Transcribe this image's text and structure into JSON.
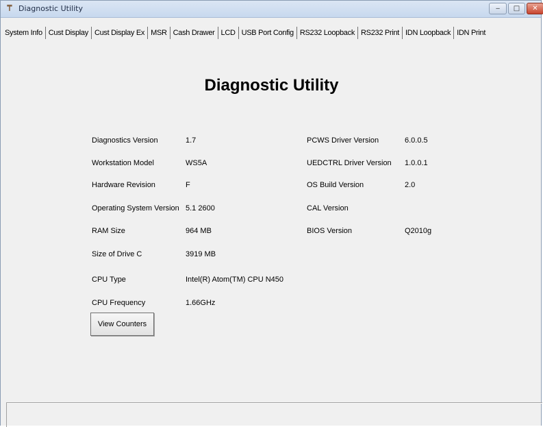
{
  "window": {
    "title": "Diagnostic Utility",
    "minimize": "‒",
    "maximize": "□",
    "close": "✕"
  },
  "tabs": [
    {
      "label": "System Info"
    },
    {
      "label": "Cust Display"
    },
    {
      "label": "Cust Display Ex"
    },
    {
      "label": "MSR"
    },
    {
      "label": "Cash Drawer"
    },
    {
      "label": "LCD"
    },
    {
      "label": "USB Port Config"
    },
    {
      "label": "RS232 Loopback"
    },
    {
      "label": "RS232 Print"
    },
    {
      "label": "IDN Loopback"
    },
    {
      "label": "IDN Print"
    }
  ],
  "heading": "Diagnostic Utility",
  "left_fields": [
    {
      "label": "Diagnostics Version",
      "value": "1.7"
    },
    {
      "label": "Workstation Model",
      "value": "WS5A"
    },
    {
      "label": "Hardware Revision",
      "value": "F"
    },
    {
      "label": "Operating System Version",
      "value": "5.1 2600"
    },
    {
      "label": "RAM Size",
      "value": "964 MB"
    },
    {
      "label": "Size of Drive C",
      "value": "3919 MB"
    },
    {
      "label": "CPU Type",
      "value": "Intel(R) Atom(TM) CPU N450"
    },
    {
      "label": "CPU Frequency",
      "value": "1.66GHz"
    }
  ],
  "right_fields": [
    {
      "label": "PCWS Driver Version",
      "value": "6.0.0.5"
    },
    {
      "label": "UEDCTRL Driver Version",
      "value": "1.0.0.1"
    },
    {
      "label": "OS Build Version",
      "value": "2.0"
    },
    {
      "label": "CAL Version",
      "value": ""
    },
    {
      "label": "BIOS Version",
      "value": "Q2010g"
    }
  ],
  "buttons": {
    "view_counters": "View Counters"
  }
}
